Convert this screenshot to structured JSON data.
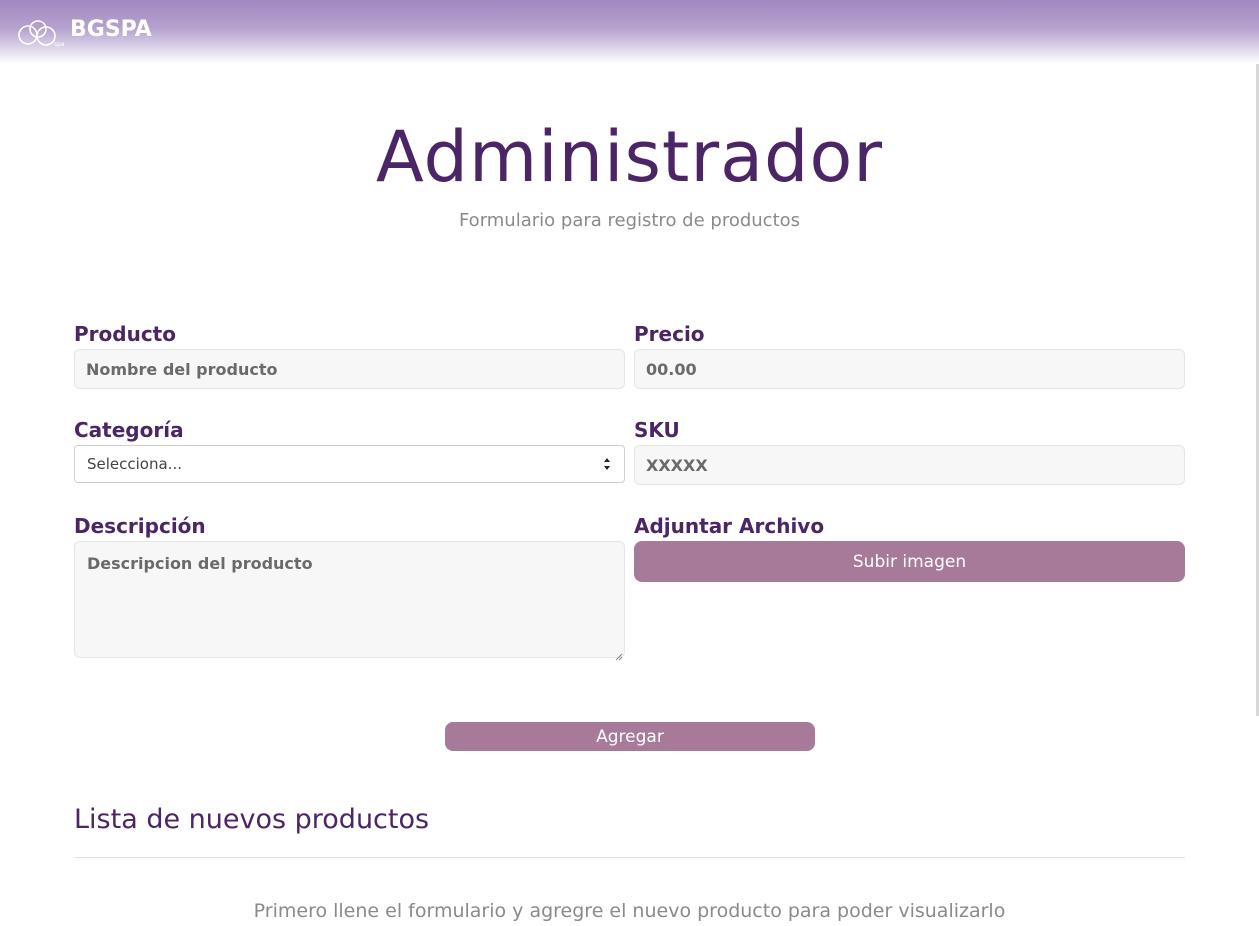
{
  "header": {
    "brand_name": "BGSPA",
    "logo_icon": "bgspa-logo-icon",
    "gradient_colors": [
      "#a188bf",
      "#ffffff"
    ]
  },
  "hero": {
    "title": "Administrador",
    "subtitle": "Formulario para registro de productos"
  },
  "form": {
    "product": {
      "label": "Producto",
      "placeholder": "Nombre del producto",
      "value": ""
    },
    "price": {
      "label": "Precio",
      "placeholder": "00.00",
      "value": ""
    },
    "category": {
      "label": "Categoría",
      "selected": "Selecciona..."
    },
    "sku": {
      "label": "SKU",
      "placeholder": "XXXXX",
      "value": ""
    },
    "description": {
      "label": "Descripción",
      "placeholder": "Descripcion del producto",
      "value": ""
    },
    "attachment": {
      "label": "Adjuntar Archivo",
      "button_label": "Subir imagen"
    },
    "submit_label": "Agregar"
  },
  "product_list": {
    "title": "Lista de nuevos productos",
    "empty_message": "Primero llene el formulario y agregre el nuevo producto para poder visualizarlo"
  },
  "colors": {
    "title": "#4b2565",
    "button": "#a87a99",
    "muted_text": "#8a8a8a"
  }
}
